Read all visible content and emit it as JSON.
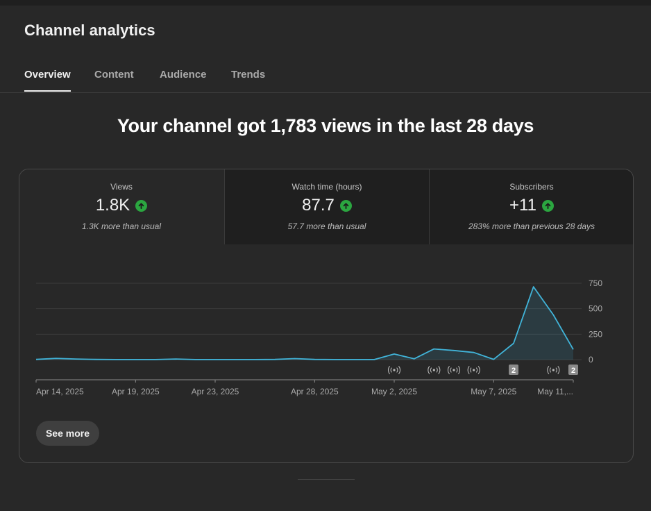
{
  "page": {
    "title": "Channel analytics",
    "tabs": [
      {
        "label": "Overview",
        "active": true
      },
      {
        "label": "Content",
        "active": false
      },
      {
        "label": "Audience",
        "active": false
      },
      {
        "label": "Trends",
        "active": false
      }
    ],
    "headline": "Your channel got 1,783 views in the last 28 days"
  },
  "metrics": [
    {
      "label": "Views",
      "value": "1.8K",
      "trend_icon": "arrow-up-circle-icon",
      "note": "1.3K more than usual"
    },
    {
      "label": "Watch time (hours)",
      "value": "87.7",
      "trend_icon": "arrow-up-circle-icon",
      "note": "57.7 more than usual"
    },
    {
      "label": "Subscribers",
      "value": "+11",
      "trend_icon": "arrow-up-circle-icon",
      "note": "283% more than previous 28 days"
    }
  ],
  "colors": {
    "background": "#282828",
    "line": "#41b4d9",
    "trend_up": "#2ba640"
  },
  "see_more_label": "See more",
  "chart_data": {
    "type": "area",
    "title": "",
    "xlabel": "",
    "ylabel": "",
    "ylim": [
      0,
      750
    ],
    "yticks": [
      "750",
      "500",
      "250",
      "0"
    ],
    "y_axis_position": "right",
    "grid": true,
    "x_tick_labels": [
      "Apr 14, 2025",
      "Apr 19, 2025",
      "Apr 23, 2025",
      "Apr 28, 2025",
      "May 2, 2025",
      "May 7, 2025",
      "May 11,..."
    ],
    "x_tick_days": [
      0,
      5,
      9,
      14,
      18,
      23,
      27
    ],
    "x": [
      "Apr 14",
      "Apr 15",
      "Apr 16",
      "Apr 17",
      "Apr 18",
      "Apr 19",
      "Apr 20",
      "Apr 21",
      "Apr 22",
      "Apr 23",
      "Apr 24",
      "Apr 25",
      "Apr 26",
      "Apr 27",
      "Apr 28",
      "Apr 29",
      "Apr 30",
      "May 1",
      "May 2",
      "May 3",
      "May 4",
      "May 5",
      "May 6",
      "May 7",
      "May 8",
      "May 9",
      "May 10",
      "May 11"
    ],
    "series": [
      {
        "values": [
          2,
          12,
          6,
          2,
          1,
          1,
          1,
          6,
          1,
          1,
          1,
          1,
          2,
          10,
          2,
          1,
          1,
          1,
          55,
          8,
          105,
          90,
          70,
          3,
          160,
          715,
          440,
          100
        ]
      }
    ],
    "markers": [
      {
        "type": "live",
        "day": 18
      },
      {
        "type": "live",
        "day": 20
      },
      {
        "type": "live",
        "day": 21
      },
      {
        "type": "live",
        "day": 22
      },
      {
        "type": "count",
        "day": 24,
        "label": "2"
      },
      {
        "type": "live",
        "day": 26
      },
      {
        "type": "count",
        "day": 27,
        "label": "2"
      }
    ]
  }
}
